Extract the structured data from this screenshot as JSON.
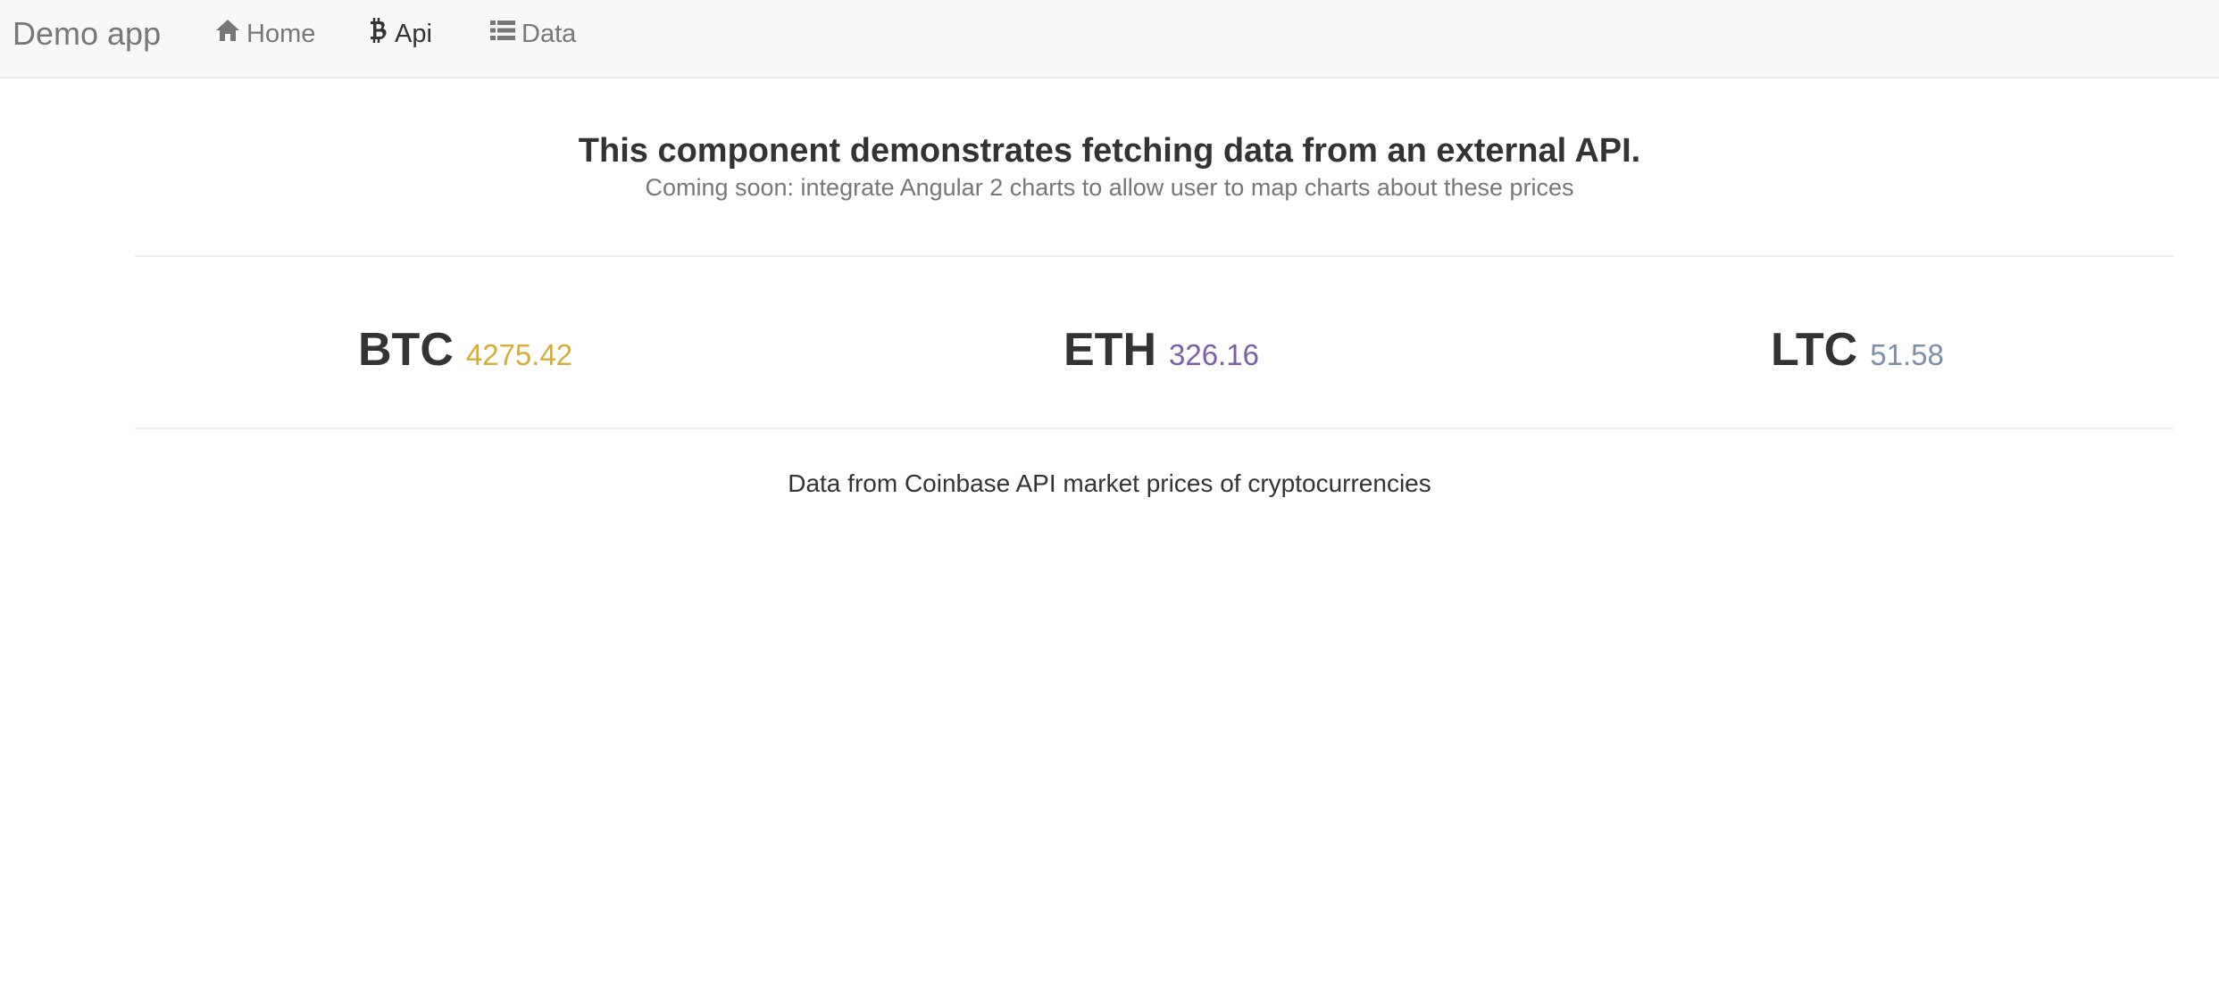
{
  "navbar": {
    "brand": "Demo app",
    "items": [
      {
        "label": "Home",
        "icon": "home-icon",
        "active": false
      },
      {
        "label": "Api",
        "icon": "bitcoin-icon",
        "active": true
      },
      {
        "label": "Data",
        "icon": "list-icon",
        "active": false
      }
    ]
  },
  "main": {
    "title": "This component demonstrates fetching data from an external API.",
    "subtitle": "Coming soon: integrate Angular 2 charts to allow user to map charts about these prices",
    "tickers": [
      {
        "symbol": "BTC",
        "price": "4275.42",
        "color": "#d4af37"
      },
      {
        "symbol": "ETH",
        "price": "326.16",
        "color": "#7b5ea7"
      },
      {
        "symbol": "LTC",
        "price": "51.58",
        "color": "#7d8fa6"
      }
    ],
    "footnote": "Data from Coinbase API market prices of cryptocurrencies"
  }
}
